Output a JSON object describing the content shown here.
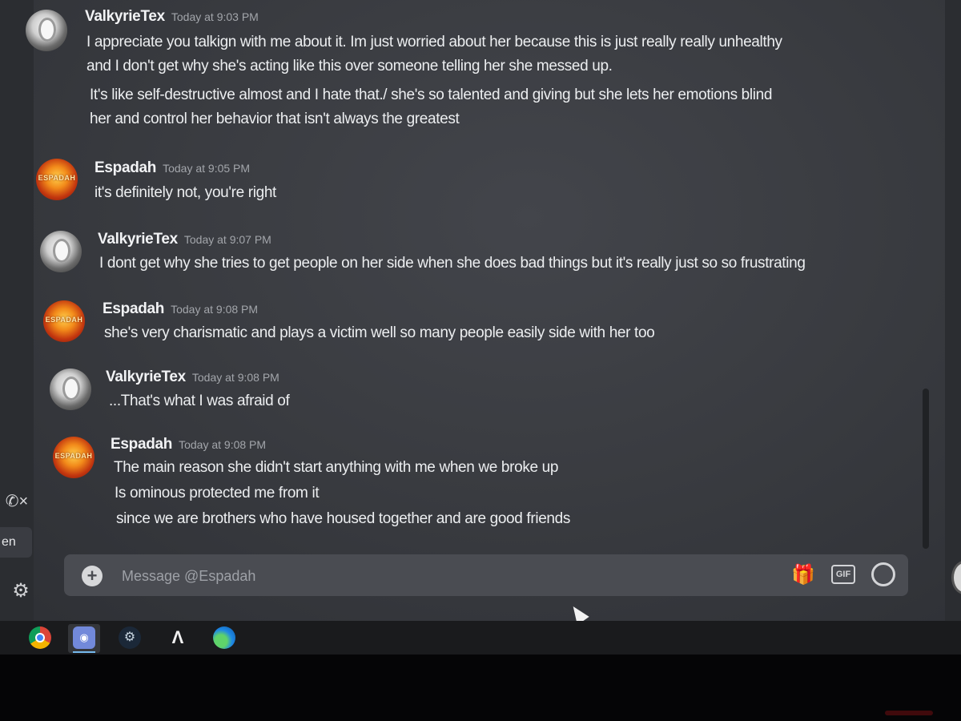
{
  "sidebar": {
    "call_icon": "phone-x-icon",
    "user_tab_label": "en",
    "settings_icon": "gear-icon"
  },
  "messages": [
    {
      "author": "ValkyrieTex",
      "time": "Today at 9:03 PM",
      "avatar": "valkyrie-avatar",
      "lines": [
        "I appreciate you talkign with me about it. Im just worried about her because this is just really really unhealthy",
        "and I don't get why she's acting like this over someone telling her she messed up.",
        "It's like self-destructive almost and I hate that./ she's so talented and giving but she lets her emotions blind",
        "her and control her behavior that isn't always the greatest"
      ]
    },
    {
      "author": "Espadah",
      "time": "Today at 9:05 PM",
      "avatar": "espadah-avatar",
      "avatar_text": "ESPADAH",
      "lines": [
        "it's definitely not, you're right"
      ]
    },
    {
      "author": "ValkyrieTex",
      "time": "Today at 9:07 PM",
      "avatar": "valkyrie-avatar",
      "lines": [
        "I dont get why she tries to get people on her side when she does bad things but it's really just so so frustrating"
      ]
    },
    {
      "author": "Espadah",
      "time": "Today at 9:08 PM",
      "avatar": "espadah-avatar",
      "avatar_text": "ESPADAH",
      "lines": [
        "she's very charismatic and plays a victim well so many people easily side with her too"
      ]
    },
    {
      "author": "ValkyrieTex",
      "time": "Today at 9:08 PM",
      "avatar": "valkyrie-avatar",
      "lines": [
        "...That's what I was afraid of"
      ]
    },
    {
      "author": "Espadah",
      "time": "Today at 9:08 PM",
      "avatar": "espadah-avatar",
      "avatar_text": "ESPADAH",
      "lines": [
        "The main reason she didn't start anything with me when we broke up",
        "Is ominous protected me from it",
        "since we are brothers who have housed together and are good friends"
      ]
    }
  ],
  "composer": {
    "placeholder": "Message @Espadah",
    "gif_label": "GIF",
    "icons": [
      "add-attachment-icon",
      "gift-icon",
      "gif-icon",
      "emoji-icon"
    ]
  },
  "taskbar": {
    "apps": [
      "chrome-icon",
      "discord-icon",
      "steam-icon",
      "adobe-acrobat-icon",
      "edge-icon"
    ],
    "active_app": "discord-icon"
  },
  "colors": {
    "background": "#3a3c41",
    "username": "#f2f3f5",
    "timestamp": "#a3a6ab",
    "message_text": "#eceef0",
    "taskbar": "#1a1b1d"
  }
}
